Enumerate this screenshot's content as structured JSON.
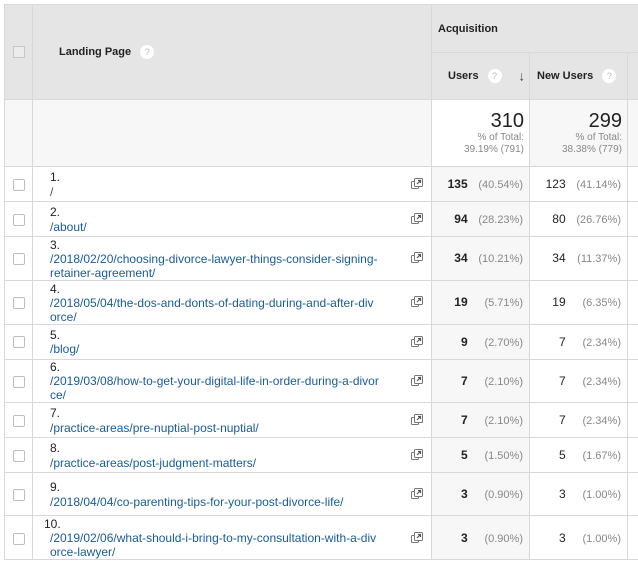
{
  "header": {
    "select_all_checked": false,
    "landing_page_label": "Landing Page",
    "help_glyph": "?",
    "group_label": "Acquisition",
    "columns": [
      {
        "label": "Users",
        "sorted": "descending",
        "sort_icon": "↓"
      },
      {
        "label": "New Users"
      }
    ]
  },
  "totals": {
    "users": {
      "value": "310",
      "pct_label": "% of Total:",
      "pct_detail": "39.19% (791)"
    },
    "new_users": {
      "value": "299",
      "pct_label": "% of Total:",
      "pct_detail": "38.38% (779)"
    }
  },
  "rows": [
    {
      "index": "1.",
      "page": "/",
      "users": "135",
      "users_pct": "(40.54%)",
      "new_users": "123",
      "new_users_pct": "(41.14%)"
    },
    {
      "index": "2.",
      "page": "/about/",
      "users": "94",
      "users_pct": "(28.23%)",
      "new_users": "80",
      "new_users_pct": "(26.76%)"
    },
    {
      "index": "3.",
      "page": "/2018/02/20/choosing-divorce-lawyer-things-consider-signing-retainer-agreement/",
      "users": "34",
      "users_pct": "(10.21%)",
      "new_users": "34",
      "new_users_pct": "(11.37%)"
    },
    {
      "index": "4.",
      "page": "/2018/05/04/the-dos-and-donts-of-dating-during-and-after-divorce/",
      "users": "19",
      "users_pct": "(5.71%)",
      "new_users": "19",
      "new_users_pct": "(6.35%)"
    },
    {
      "index": "5.",
      "page": "/blog/",
      "users": "9",
      "users_pct": "(2.70%)",
      "new_users": "7",
      "new_users_pct": "(2.34%)"
    },
    {
      "index": "6.",
      "page": "/2019/03/08/how-to-get-your-digital-life-in-order-during-a-divorce/",
      "users": "7",
      "users_pct": "(2.10%)",
      "new_users": "7",
      "new_users_pct": "(2.34%)"
    },
    {
      "index": "7.",
      "page": "/practice-areas/pre-nuptial-post-nuptial/",
      "users": "7",
      "users_pct": "(2.10%)",
      "new_users": "7",
      "new_users_pct": "(2.34%)"
    },
    {
      "index": "8.",
      "page": "/practice-areas/post-judgment-matters/",
      "users": "5",
      "users_pct": "(1.50%)",
      "new_users": "5",
      "new_users_pct": "(1.67%)"
    },
    {
      "index": "9.",
      "page": "/2018/04/04/co-parenting-tips-for-your-post-divorce-life/",
      "users": "3",
      "users_pct": "(0.90%)",
      "new_users": "3",
      "new_users_pct": "(1.00%)"
    },
    {
      "index": "10.",
      "page": "/2019/02/06/what-should-i-bring-to-my-consultation-with-a-divorce-lawyer/",
      "users": "3",
      "users_pct": "(0.90%)",
      "new_users": "3",
      "new_users_pct": "(1.00%)"
    }
  ],
  "icons": {
    "row_action": "open-in-new-window-icon",
    "help": "help-icon",
    "sort": "arrow-down-icon"
  },
  "colors": {
    "link": "#1a5c96",
    "header_bg": "#e5e5e5",
    "highlight_col_bg": "#f7f7f7",
    "border": "#d8d8d8"
  }
}
